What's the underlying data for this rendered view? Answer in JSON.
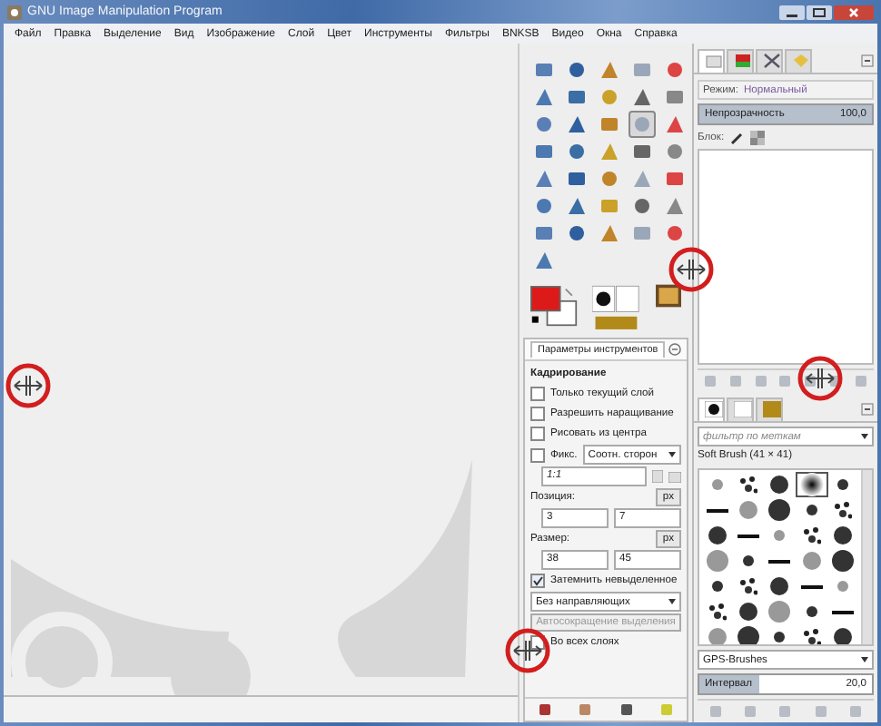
{
  "window": {
    "title": "GNU Image Manipulation Program"
  },
  "menu": [
    "Файл",
    "Правка",
    "Выделение",
    "Вид",
    "Изображение",
    "Слой",
    "Цвет",
    "Инструменты",
    "Фильтры",
    "BNKSB",
    "Видео",
    "Окна",
    "Справка"
  ],
  "toolbox": {
    "tools": [
      {
        "selected": false
      },
      {
        "selected": false
      },
      {
        "selected": false
      },
      {
        "selected": false
      },
      {
        "selected": false
      },
      {
        "selected": false
      },
      {
        "selected": false
      },
      {
        "selected": false
      },
      {
        "selected": false
      },
      {
        "selected": false
      },
      {
        "selected": false
      },
      {
        "selected": false
      },
      {
        "selected": false
      },
      {
        "selected": true
      },
      {
        "selected": false
      },
      {
        "selected": false
      },
      {
        "selected": false
      },
      {
        "selected": false
      },
      {
        "selected": false
      },
      {
        "selected": false
      },
      {
        "selected": false
      },
      {
        "selected": false
      },
      {
        "selected": false
      },
      {
        "selected": false
      },
      {
        "selected": false
      },
      {
        "selected": false
      },
      {
        "selected": false
      },
      {
        "selected": false
      },
      {
        "selected": false
      },
      {
        "selected": false
      },
      {
        "selected": false
      },
      {
        "selected": false
      },
      {
        "selected": false
      },
      {
        "selected": false
      },
      {
        "selected": false
      },
      {
        "selected": false
      }
    ]
  },
  "tool_options": {
    "tab": "Параметры инструментов",
    "rows": [
      {
        "kind": "heading",
        "label": "Кадрирование"
      },
      {
        "kind": "checkbox",
        "label": "Только текущий слой",
        "checked": false
      },
      {
        "kind": "checkbox",
        "label": "Разрешить наращивание",
        "checked": false
      },
      {
        "kind": "checkbox",
        "label": "Рисовать из центра",
        "checked": false
      },
      {
        "kind": "fixed",
        "label": "Фикс.",
        "checked": false,
        "value": "Соотн. сторон"
      },
      {
        "kind": "ratio",
        "value": "1:1"
      },
      {
        "kind": "unit_label",
        "label": "Позиция:",
        "unit": "px"
      },
      {
        "kind": "pair",
        "values": [
          "3",
          "7"
        ]
      },
      {
        "kind": "unit_label",
        "label": "Размер:",
        "unit": "px"
      },
      {
        "kind": "pair",
        "values": [
          "38",
          "45"
        ]
      },
      {
        "kind": "checkbox",
        "label": "Затемнить невыделенное",
        "checked": true
      },
      {
        "kind": "dropdown",
        "value": "Без направляющих"
      },
      {
        "kind": "button",
        "label": "Автосокращение выделения",
        "disabled": true
      },
      {
        "kind": "checkbox",
        "label": "Во всех слоях",
        "checked": false
      }
    ]
  },
  "layers": {
    "tabs": [
      {
        "selected": true
      },
      {
        "selected": false
      },
      {
        "selected": false
      },
      {
        "selected": false
      }
    ],
    "mode_label": "Режим:",
    "mode": "Нормальный",
    "opacity": {
      "label": "Непрозрачность",
      "reading": "100,0",
      "level": 1
    },
    "lock_label": "Блок:"
  },
  "brushes": {
    "tabs": [
      {
        "selected": true
      },
      {
        "selected": false
      },
      {
        "selected": false
      }
    ],
    "filter_placeholder": "фильтр по меткам",
    "current": "Soft Brush (41 × 41)",
    "items": [
      {
        "selected": false
      },
      {
        "selected": false
      },
      {
        "selected": false
      },
      {
        "selected": true
      },
      {
        "selected": false
      },
      {
        "selected": false
      },
      {
        "selected": false
      },
      {
        "selected": false
      },
      {
        "selected": false
      },
      {
        "selected": false
      },
      {
        "selected": false
      },
      {
        "selected": false
      },
      {
        "selected": false
      },
      {
        "selected": false
      },
      {
        "selected": false
      },
      {
        "selected": false
      },
      {
        "selected": false
      },
      {
        "selected": false
      },
      {
        "selected": false
      },
      {
        "selected": false
      },
      {
        "selected": false
      },
      {
        "selected": false
      },
      {
        "selected": false
      },
      {
        "selected": false
      },
      {
        "selected": false
      },
      {
        "selected": false
      },
      {
        "selected": false
      },
      {
        "selected": false
      },
      {
        "selected": false
      },
      {
        "selected": false
      },
      {
        "selected": false
      },
      {
        "selected": false
      },
      {
        "selected": false
      },
      {
        "selected": false
      },
      {
        "selected": false
      }
    ],
    "tag": "GPS-Brushes",
    "spacing": {
      "label": "Интервал",
      "reading": "20,0",
      "level": 0.35
    }
  }
}
